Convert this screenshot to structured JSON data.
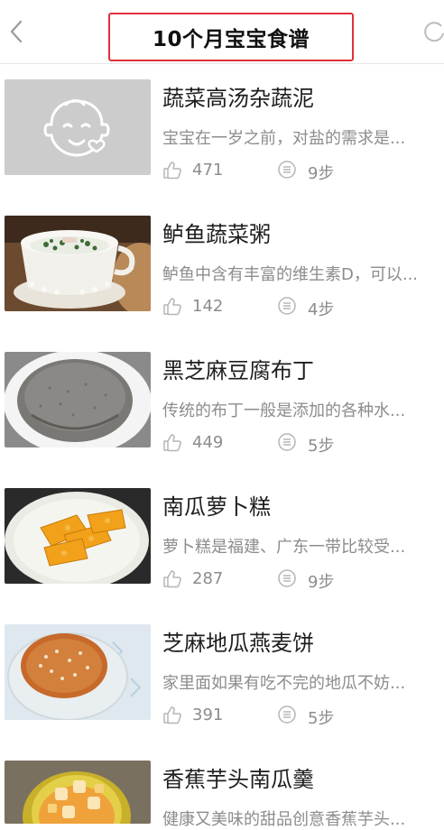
{
  "header": {
    "title": "10个月宝宝食谱"
  },
  "recipes": [
    {
      "title": "蔬菜高汤杂蔬泥",
      "desc": "宝宝在一岁之前，对盐的需求是...",
      "likes": "471",
      "steps": "9步",
      "image": "placeholder-baby-icon"
    },
    {
      "title": "鲈鱼蔬菜粥",
      "desc": "鲈鱼中含有丰富的维生素D，可以...",
      "likes": "142",
      "steps": "4步",
      "image": "fish-vegetable-porridge-bowl"
    },
    {
      "title": "黑芝麻豆腐布丁",
      "desc": "传统的布丁一般是添加的各种水...",
      "likes": "449",
      "steps": "5步",
      "image": "black-sesame-pudding"
    },
    {
      "title": "南瓜萝卜糕",
      "desc": "萝卜糕是福建、广东一带比较受...",
      "likes": "287",
      "steps": "9步",
      "image": "pumpkin-radish-cake-plate"
    },
    {
      "title": "芝麻地瓜燕麦饼",
      "desc": "家里面如果有吃不完的地瓜不妨...",
      "likes": "391",
      "steps": "5步",
      "image": "sesame-sweet-potato-oat-cake"
    },
    {
      "title": "香蕉芋头南瓜羹",
      "desc": "健康又美味的甜品创意香蕉芋头...",
      "likes": "",
      "steps": "",
      "image": "banana-taro-pumpkin-soup-bowl"
    }
  ],
  "colors": {
    "highlight_border": "#e0303a",
    "muted_text": "#8c8c8c",
    "placeholder_bg": "#cccccc"
  }
}
